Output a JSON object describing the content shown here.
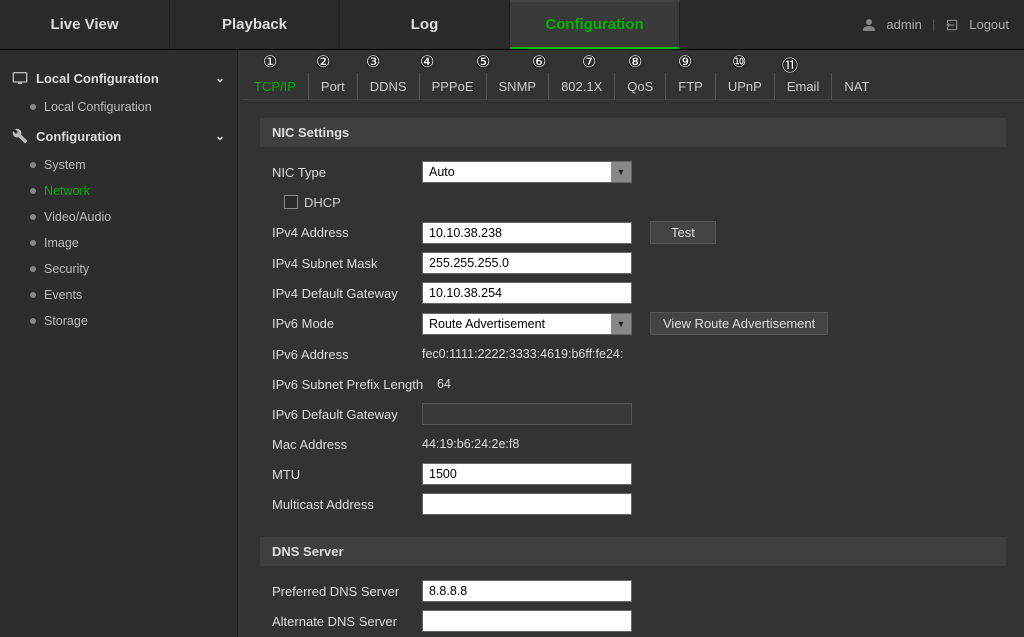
{
  "topnav": {
    "items": [
      "Live View",
      "Playback",
      "Log",
      "Configuration"
    ],
    "active_index": 3,
    "user": "admin",
    "logout": "Logout"
  },
  "sidebar": {
    "sections": [
      {
        "title": "Local Configuration",
        "items": [
          "Local Configuration"
        ],
        "active_item": null
      },
      {
        "title": "Configuration",
        "items": [
          "System",
          "Network",
          "Video/Audio",
          "Image",
          "Security",
          "Events",
          "Storage"
        ],
        "active_item": "Network"
      }
    ]
  },
  "subtabs": {
    "items": [
      "TCP/IP",
      "Port",
      "DDNS",
      "PPPoE",
      "SNMP",
      "802.1X",
      "QoS",
      "FTP",
      "UPnP",
      "Email",
      "NAT"
    ],
    "active_index": 0,
    "annotations": [
      "①",
      "②",
      "③",
      "④",
      "⑤",
      "⑥",
      "⑦",
      "⑧",
      "⑨",
      "⑩",
      "⑪"
    ]
  },
  "nic_settings": {
    "header": "NIC Settings",
    "nic_type_label": "NIC Type",
    "nic_type_value": "Auto",
    "dhcp_label": "DHCP",
    "dhcp_checked": false,
    "ipv4_addr_label": "IPv4 Address",
    "ipv4_addr_value": "10.10.38.238",
    "test_label": "Test",
    "ipv4_mask_label": "IPv4 Subnet Mask",
    "ipv4_mask_value": "255.255.255.0",
    "ipv4_gw_label": "IPv4 Default Gateway",
    "ipv4_gw_value": "10.10.38.254",
    "ipv6_mode_label": "IPv6 Mode",
    "ipv6_mode_value": "Route Advertisement",
    "view_route_label": "View Route Advertisement",
    "ipv6_addr_label": "IPv6 Address",
    "ipv6_addr_value": "fec0:1111:2222:3333:4619:b6ff:fe24:",
    "ipv6_prefix_label": "IPv6 Subnet Prefix Length",
    "ipv6_prefix_value": "64",
    "ipv6_gw_label": "IPv6 Default Gateway",
    "ipv6_gw_value": "",
    "mac_label": "Mac Address",
    "mac_value": "44:19:b6:24:2e:f8",
    "mtu_label": "MTU",
    "mtu_value": "1500",
    "multicast_label": "Multicast Address",
    "multicast_value": ""
  },
  "dns": {
    "header": "DNS Server",
    "preferred_label": "Preferred DNS Server",
    "preferred_value": "8.8.8.8",
    "alternate_label": "Alternate DNS Server",
    "alternate_value": ""
  },
  "annot_positions": [
    25,
    78,
    128,
    182,
    238,
    294,
    344,
    390,
    440,
    494,
    544
  ]
}
